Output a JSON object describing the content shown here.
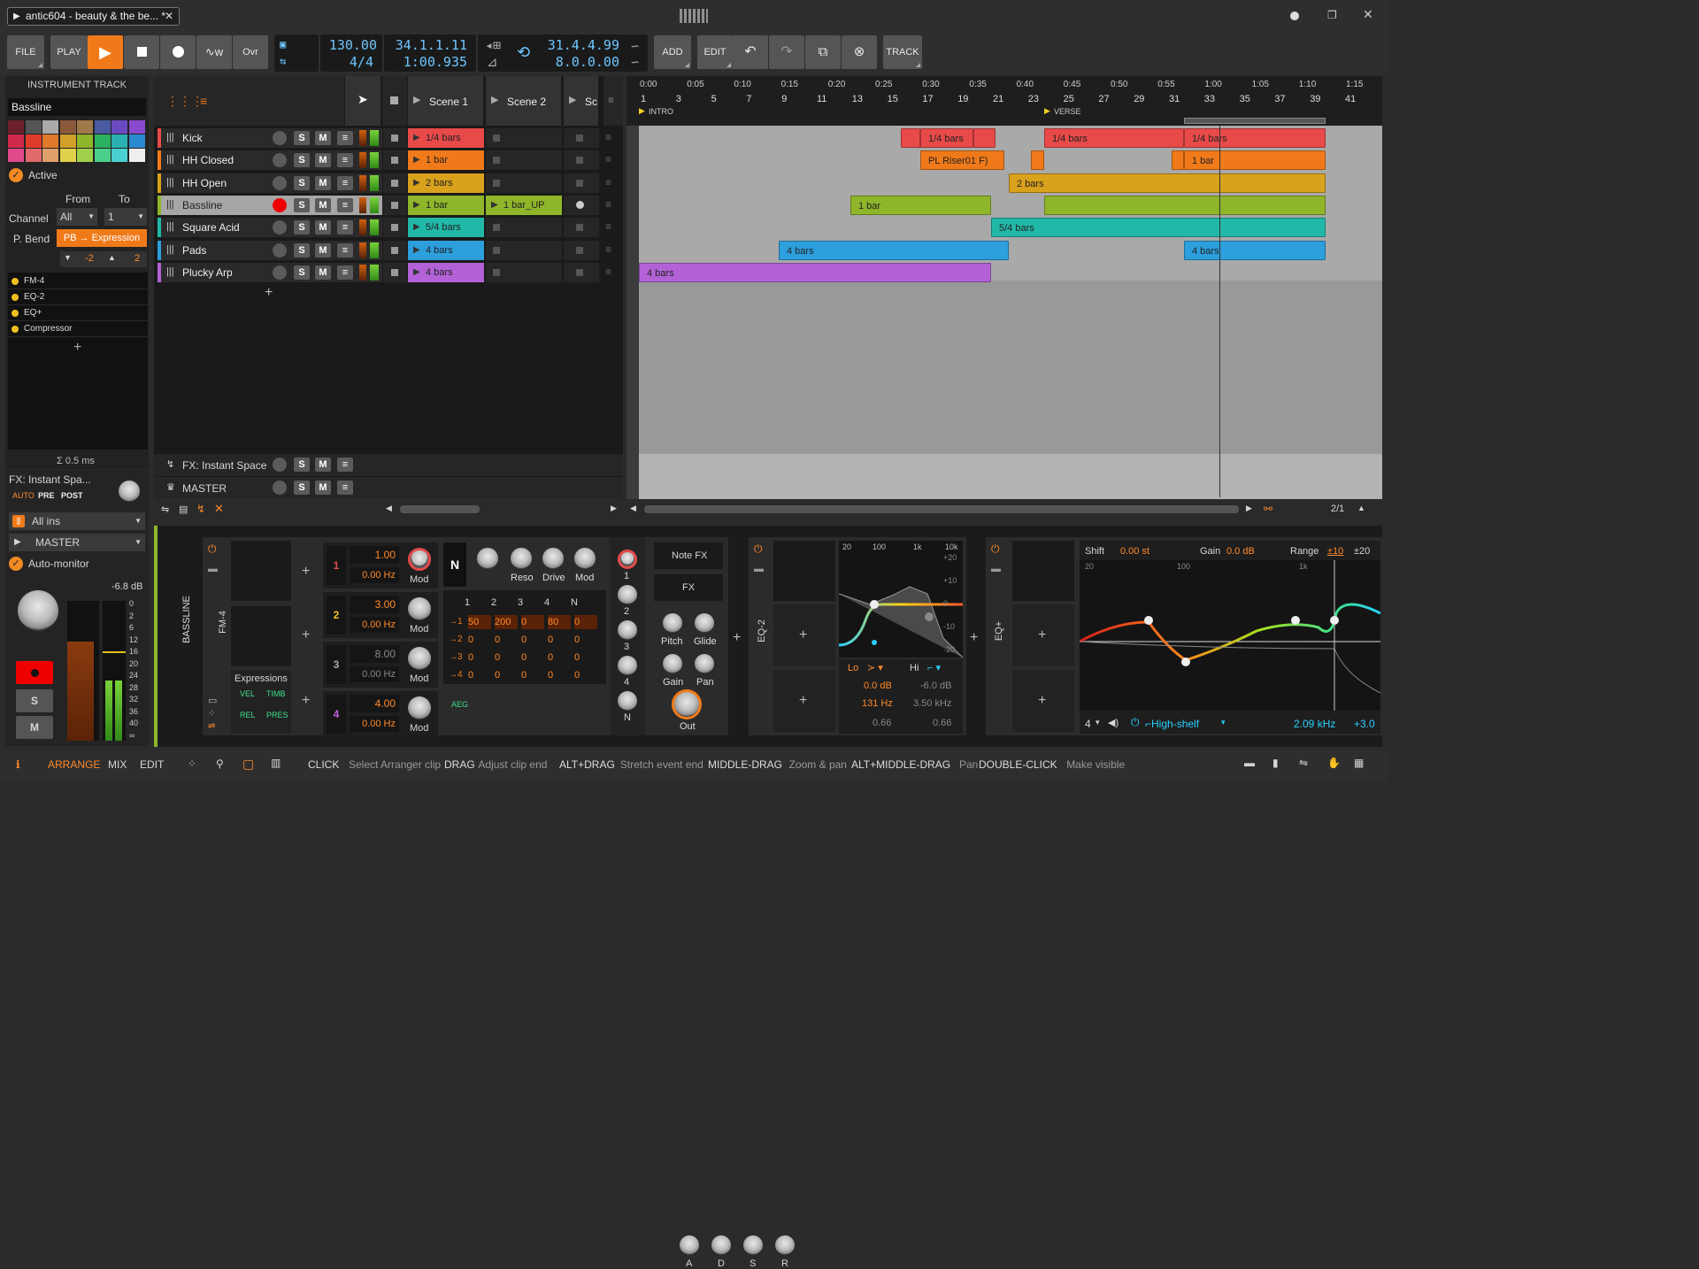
{
  "title_tab": {
    "label": "antic604 - beauty & the be... *"
  },
  "toolbar": {
    "file": "FILE",
    "play": "PLAY",
    "ovr": "Ovr",
    "tempo": "130.00",
    "signature": "4/4",
    "position_bars": "34.1.1.11",
    "position_time": "1:00.935",
    "loop_end": "31.4.4.99",
    "loop_length": "8.0.0.00",
    "add": "ADD",
    "edit": "EDIT",
    "track": "TRACK"
  },
  "inspector": {
    "header": "INSTRUMENT TRACK",
    "track_name": "Bassline",
    "active": "Active",
    "from": "From",
    "to": "To",
    "channel_label": "Channel",
    "channel_from": "All",
    "channel_to": "1",
    "pbend_label": "P. Bend",
    "pbend_value": "PB → Expression",
    "pb_down": "-2",
    "pb_up": "2",
    "devices": [
      "FM-4",
      "EQ-2",
      "EQ+",
      "Compressor"
    ],
    "latency": "Σ 0.5 ms",
    "fx_label": "FX: Instant Spa...",
    "auto": "AUTO",
    "pre": "PRE",
    "post": "POST",
    "input": "All ins",
    "output": "MASTER",
    "auto_monitor": "Auto-monitor",
    "level": "-6.8 dB",
    "meter_scale": [
      "0",
      "2",
      "6",
      "12",
      "16",
      "20",
      "24",
      "28",
      "32",
      "36",
      "40",
      "∞"
    ],
    "s": "S",
    "m": "M"
  },
  "tracks": [
    {
      "name": "Kick",
      "color": "#e84a4a",
      "clip": "1/4 bars"
    },
    {
      "name": "HH Closed",
      "color": "#f07a1a",
      "clip": "1 bar"
    },
    {
      "name": "HH Open",
      "color": "#d9a11c",
      "clip": "2 bars"
    },
    {
      "name": "Bassline",
      "color": "#8fb52a",
      "clip": "1 bar",
      "clip2": "1 bar_UP"
    },
    {
      "name": "Square Acid",
      "color": "#22b8a8",
      "clip": "5/4 bars"
    },
    {
      "name": "Pads",
      "color": "#2c9fdc",
      "clip": "4 bars"
    },
    {
      "name": "Plucky Arp",
      "color": "#b262d6",
      "clip": "4 bars"
    }
  ],
  "fx_track": "FX: Instant Space",
  "master_track": "MASTER",
  "scenes": [
    "Scene 1",
    "Scene 2",
    "Sc"
  ],
  "ruler": {
    "times": [
      "0:00",
      "0:05",
      "0:10",
      "0:15",
      "0:20",
      "0:25",
      "0:30",
      "0:35",
      "0:40",
      "0:45",
      "0:50",
      "0:55",
      "1:00",
      "1:05",
      "1:10",
      "1:15"
    ],
    "bars": [
      "1",
      "3",
      "5",
      "7",
      "9",
      "11",
      "13",
      "15",
      "17",
      "19",
      "21",
      "23",
      "25",
      "27",
      "29",
      "31",
      "33",
      "35",
      "37",
      "39",
      "41"
    ],
    "markers": [
      "INTRO",
      "VERSE"
    ],
    "zoom": "2/1"
  },
  "arranger_clips": {
    "kick_a": "1/4 bars",
    "kick_b": "1/4 bars",
    "kick_c": "1/4 bars",
    "hh_a": "PL Riser01 F)",
    "hh_b": "1 bar",
    "open_a": "2 bars",
    "bass": "1 bar",
    "acid": "5/4 bars",
    "pads_a": "4 bars",
    "pads_b": "4 bars",
    "arp": "4 bars"
  },
  "devices": {
    "track_label": "BASSLINE",
    "fm4": {
      "label": "FM-4",
      "expressions": "Expressions",
      "vel": "VEL",
      "timb": "TIMB",
      "rel": "REL",
      "pres": "PRES",
      "ops": [
        {
          "n": "1",
          "ratio": "1.00",
          "hz": "0.00 Hz",
          "mod": "Mod"
        },
        {
          "n": "2",
          "ratio": "3.00",
          "hz": "0.00 Hz",
          "mod": "Mod"
        },
        {
          "n": "3",
          "ratio": "8.00",
          "hz": "0.00 Hz",
          "mod": "Mod"
        },
        {
          "n": "4",
          "ratio": "4.00",
          "hz": "0.00 Hz",
          "mod": "Mod"
        }
      ],
      "filter": {
        "n": "N",
        "reso": "Reso",
        "drive": "Drive",
        "mod": "Mod"
      },
      "matrix_cols": [
        "1",
        "2",
        "3",
        "4",
        "N"
      ],
      "matrix": [
        [
          "→1",
          "50",
          "200",
          "0",
          "80",
          "0"
        ],
        [
          "→2",
          "0",
          "0",
          "0",
          "0",
          "0"
        ],
        [
          "→3",
          "0",
          "0",
          "0",
          "0",
          "0"
        ],
        [
          "→4",
          "0",
          "0",
          "0",
          "0",
          "0"
        ]
      ],
      "aeg": "AEG",
      "adsr": [
        "A",
        "D",
        "S",
        "R"
      ],
      "outs": [
        "1",
        "2",
        "3",
        "4",
        "N"
      ],
      "note_fx": "Note FX",
      "fx": "FX",
      "pitch": "Pitch",
      "glide": "Glide",
      "gain": "Gain",
      "pan": "Pan",
      "out": "Out"
    },
    "eq2": {
      "label": "EQ-2",
      "scale_x": [
        "20",
        "100",
        "1k",
        "10k"
      ],
      "scale_y": [
        "+20",
        "+10",
        "0",
        "-10",
        "-20"
      ],
      "lo": "Lo",
      "hi": "Hi",
      "lo_gain": "0.0 dB",
      "hi_gain": "-6.0 dB",
      "lo_freq": "131 Hz",
      "hi_freq": "3.50 kHz",
      "lo_q": "0.66",
      "hi_q": "0.66"
    },
    "eqplus": {
      "label": "EQ+",
      "shift": "Shift",
      "shift_val": "0.00 st",
      "gain": "Gain",
      "gain_val": "0.0 dB",
      "range": "Range",
      "range_a": "±10",
      "range_b": "±20",
      "scale_x": [
        "20",
        "100",
        "1k"
      ],
      "band": "4",
      "band_type": "High-shelf",
      "freq": "2.09 kHz",
      "band_gain": "+3.0"
    }
  },
  "statusbar": {
    "arrange": "ARRANGE",
    "mix": "MIX",
    "edit": "EDIT",
    "hints": [
      {
        "k": "CLICK",
        "v": "Select Arranger clip"
      },
      {
        "k": "DRAG",
        "v": "Adjust clip end"
      },
      {
        "k": "ALT+DRAG",
        "v": "Stretch event end"
      },
      {
        "k": "MIDDLE-DRAG",
        "v": "Zoom & pan"
      },
      {
        "k": "ALT+MIDDLE-DRAG",
        "v": "Pan"
      },
      {
        "k": "DOUBLE-CLICK",
        "v": "Make visible"
      }
    ]
  }
}
